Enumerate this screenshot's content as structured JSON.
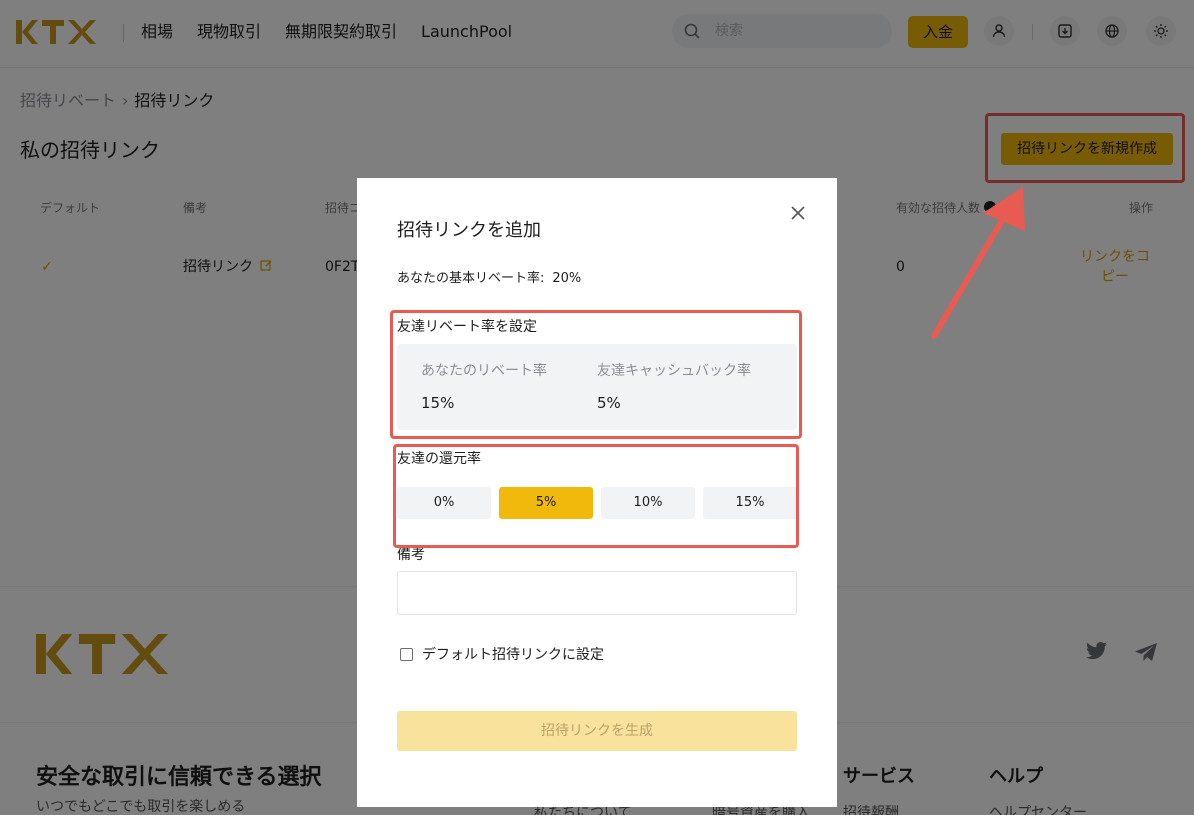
{
  "header": {
    "logo_text": "KTX",
    "nav": [
      "相場",
      "現物取引",
      "無期限契約取引",
      "LaunchPool"
    ],
    "search_placeholder": "検索",
    "deposit_label": "入金",
    "icons": [
      "user-icon",
      "download-icon",
      "globe-icon",
      "theme-icon"
    ]
  },
  "breadcrumb": {
    "parent": "招待リベート",
    "separator": "›",
    "current": "招待リンク"
  },
  "page": {
    "title": "私の招待リンク",
    "create_button": "招待リンクを新規作成"
  },
  "table": {
    "headers": {
      "default": "デフォルト",
      "note": "備考",
      "code": "招待コ",
      "valid_invites": "有効な招待人数",
      "actions": "操作"
    },
    "row": {
      "default_mark": "✓",
      "note": "招待リンク",
      "code": "0F2T",
      "valid_invites": "0",
      "action": "リンクをコピー"
    }
  },
  "footer": {
    "logo_text": "KTX",
    "tagline": "安全な取引に信頼できる選択",
    "subtagline": "いつでもどこでも取引を楽しめる",
    "columns": [
      {
        "title": "サービス",
        "item": "招待報酬"
      },
      {
        "title": "ヘルプ",
        "item": "ヘルプセンター"
      }
    ],
    "extra_items": [
      "私たちについて",
      "暗号資産を購入"
    ]
  },
  "modal": {
    "title": "招待リンクを追加",
    "base_rate_label": "あなたの基本リベート率:",
    "base_rate_value": "20%",
    "set_rate_label": "友達リベート率を設定",
    "your_rate_label": "あなたのリベート率",
    "your_rate_value": "15%",
    "friend_cashback_label": "友達キャッシュバック率",
    "friend_cashback_value": "5%",
    "return_rate_label": "友達の還元率",
    "options": [
      "0%",
      "5%",
      "10%",
      "15%"
    ],
    "selected_option": "5%",
    "note_label": "備考",
    "note_value": "",
    "default_checkbox_label": "デフォルト招待リンクに設定",
    "default_checked": false,
    "submit_label": "招待リンクを生成"
  },
  "colors": {
    "brand": "#f0b90b",
    "annotation": "#e85b53",
    "link": "#d9a300"
  }
}
